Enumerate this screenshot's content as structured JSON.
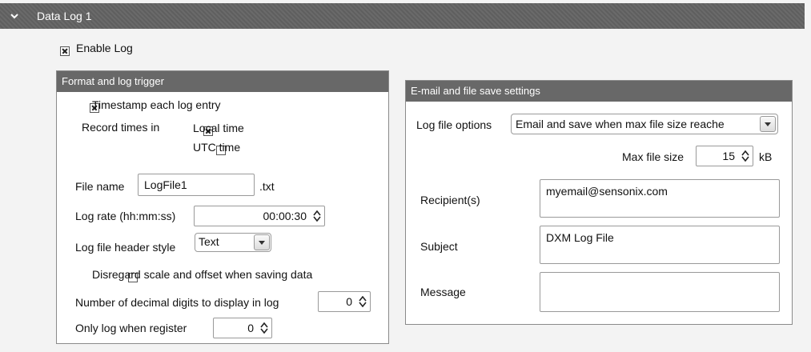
{
  "header": {
    "title": "Data Log 1"
  },
  "enable_log": {
    "label": "Enable Log",
    "checked": true
  },
  "format_panel": {
    "title": "Format and log trigger",
    "timestamp": {
      "label": "Timestamp each log entry",
      "checked": true
    },
    "record_times_label": "Record times in",
    "local_time": {
      "label": "Local time",
      "checked": true
    },
    "utc_time": {
      "label": "UTC time",
      "checked": false
    },
    "file_name": {
      "label": "File name",
      "value": "LogFile1",
      "ext": ".txt"
    },
    "log_rate": {
      "label": "Log rate (hh:mm:ss)",
      "value": "00:00:30"
    },
    "header_style": {
      "label": "Log file header style",
      "value": "Text"
    },
    "disregard": {
      "label": "Disregard scale and offset when saving data",
      "checked": false
    },
    "decimal_digits": {
      "label": "Number of decimal digits to display in log",
      "value": "0"
    },
    "only_log": {
      "label": "Only log when register",
      "value": "0"
    }
  },
  "email_panel": {
    "title": "E-mail and file save settings",
    "log_file_options": {
      "label": "Log file options",
      "value": "Email and save when max file size reache"
    },
    "max_file_size": {
      "label": "Max file size",
      "value": "15",
      "unit": "kB"
    },
    "recipients": {
      "label": "Recipient(s)",
      "value": "myemail@sensonix.com"
    },
    "subject": {
      "label": "Subject",
      "value": "DXM Log File"
    },
    "message": {
      "label": "Message",
      "value": ""
    }
  }
}
